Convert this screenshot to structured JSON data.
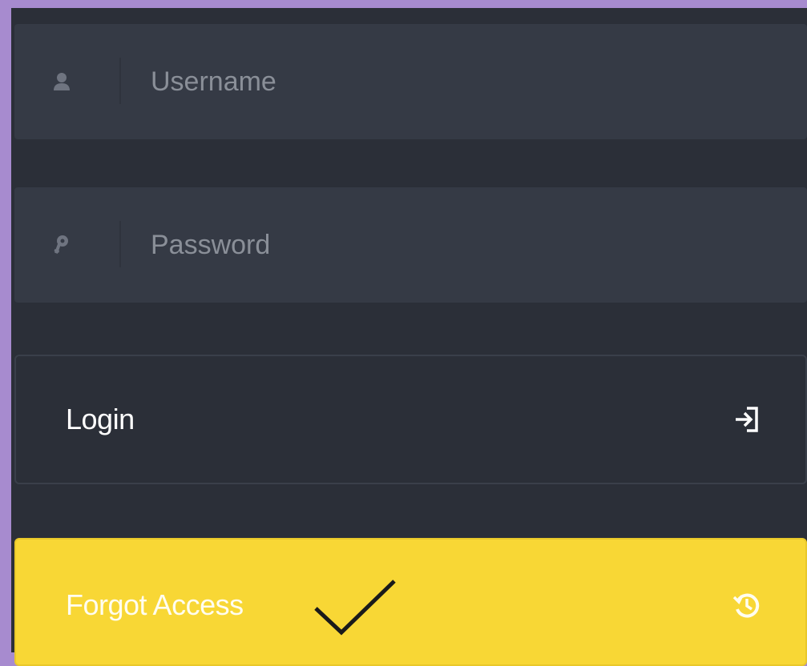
{
  "form": {
    "username": {
      "placeholder": "Username",
      "value": "",
      "icon": "user-icon"
    },
    "password": {
      "placeholder": "Password",
      "value": "",
      "icon": "key-icon"
    },
    "login_button": {
      "label": "Login",
      "icon": "sign-in-icon"
    },
    "forgot_button": {
      "label": "Forgot Access",
      "icon": "history-icon"
    }
  },
  "colors": {
    "frame": "#a78bcf",
    "panel_background": "#2b2f38",
    "field_background": "#353a45",
    "accent_yellow": "#f8d735"
  }
}
